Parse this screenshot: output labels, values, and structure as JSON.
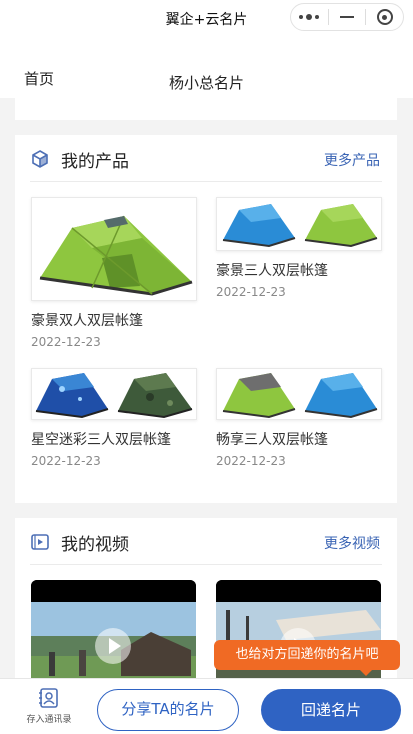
{
  "app": {
    "title": "翼企+云名片"
  },
  "header": {
    "home_label": "首页",
    "page_title": "杨小总名片"
  },
  "products": {
    "title": "我的产品",
    "more_label": "更多产品",
    "icon": "cube-icon",
    "items": [
      {
        "name": "豪景双人双层帐篷",
        "date": "2022-12-23"
      },
      {
        "name": "豪景三人双层帐篷",
        "date": "2022-12-23"
      },
      {
        "name": "星空迷彩三人双层帐篷",
        "date": "2022-12-23"
      },
      {
        "name": "畅享三人双层帐篷",
        "date": "2022-12-23"
      }
    ]
  },
  "videos": {
    "title": "我的视频",
    "more_label": "更多视频",
    "icon": "video-play-icon"
  },
  "toast": {
    "text": "也给对方回递你的名片吧"
  },
  "bottom_bar": {
    "save_label": "存入通讯录",
    "share_label": "分享TA的名片",
    "reply_label": "回递名片"
  },
  "colors": {
    "accent": "#2f63c3",
    "toast": "#f06a24",
    "tent_green": "#8bc34a",
    "tent_blue": "#2f8fd8"
  }
}
